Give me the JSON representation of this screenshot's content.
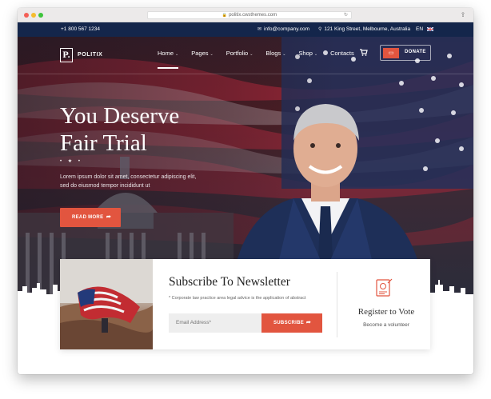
{
  "browser": {
    "url": "politix.cwsthemes.com"
  },
  "topbar": {
    "phone": "+1  800  567  1234",
    "email": "info@company.com",
    "address": "121 King Street, Melbourne, Australia",
    "language": "EN"
  },
  "nav": {
    "logo_letter": "P.",
    "logo_text": "POLITIX",
    "items": [
      {
        "label": "Home",
        "chevron": true
      },
      {
        "label": "Pages",
        "chevron": true
      },
      {
        "label": "Portfolio",
        "chevron": true
      },
      {
        "label": "Blogs",
        "chevron": true
      },
      {
        "label": "Shop",
        "chevron": true
      },
      {
        "label": "Contacts",
        "chevron": false
      }
    ],
    "donate_label": "DONATE"
  },
  "hero": {
    "headline_line1": "You Deserve",
    "headline_line2": "Fair Trial",
    "stars": "• ★ •",
    "lead_text": "Lorem ipsum dolor sit amet, consectetur adipiscing elit, sed do eiusmod tempor incididunt ut",
    "button_label": "READ MORE"
  },
  "newsletter": {
    "title": "Subscribe To Newsletter",
    "note": "* Corporate law practice area legal advice is the application of abstract",
    "email_placeholder": "Email Address*",
    "button_label": "SUBSCRIBE"
  },
  "vote": {
    "title": "Register to Vote",
    "subtitle": "Become a volunteer"
  },
  "colors": {
    "accent": "#e2553f",
    "topbar": "#14264b"
  }
}
